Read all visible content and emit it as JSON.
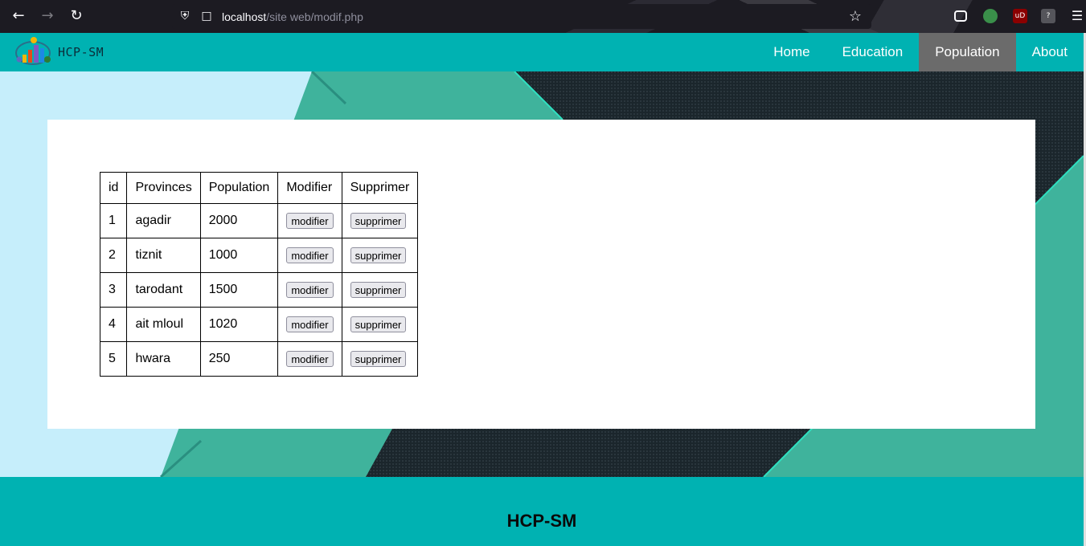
{
  "browser": {
    "url_host": "localhost",
    "url_path": "/site web/modif.php"
  },
  "site": {
    "logo_text": "HCP-SM",
    "nav": [
      {
        "label": "Home",
        "active": false
      },
      {
        "label": "Education",
        "active": false
      },
      {
        "label": "Population",
        "active": true
      },
      {
        "label": "About",
        "active": false
      }
    ]
  },
  "table": {
    "headers": [
      "id",
      "Provinces",
      "Population",
      "Modifier",
      "Supprimer"
    ],
    "rows": [
      {
        "id": "1",
        "province": "agadir",
        "population": "2000",
        "modifier": "modifier",
        "supprimer": "supprimer"
      },
      {
        "id": "2",
        "province": "tiznit",
        "population": "1000",
        "modifier": "modifier",
        "supprimer": "supprimer"
      },
      {
        "id": "3",
        "province": "tarodant",
        "population": "1500",
        "modifier": "modifier",
        "supprimer": "supprimer"
      },
      {
        "id": "4",
        "province": "ait mloul",
        "population": "1020",
        "modifier": "modifier",
        "supprimer": "supprimer"
      },
      {
        "id": "5",
        "province": "hwara",
        "population": "250",
        "modifier": "modifier",
        "supprimer": "supprimer"
      }
    ]
  },
  "footer": {
    "title": "HCP-SM"
  },
  "colors": {
    "header_bg": "#00b2b2",
    "active_nav_bg": "#6b6b6b",
    "page_bg": "#c6eefb",
    "accent_green": "#3fb39c",
    "dark_pattern": "#1e2a30"
  },
  "icons": {
    "back": "back-arrow-icon",
    "forward": "forward-arrow-icon",
    "reload": "reload-icon",
    "shield": "shield-icon",
    "page": "page-icon",
    "bookmark": "star-icon",
    "pocket": "pocket-icon",
    "extension1": "globe-extension-icon",
    "extension2": "ublock-icon",
    "extension3": "shield-extension-icon",
    "menu": "hamburger-menu-icon"
  }
}
